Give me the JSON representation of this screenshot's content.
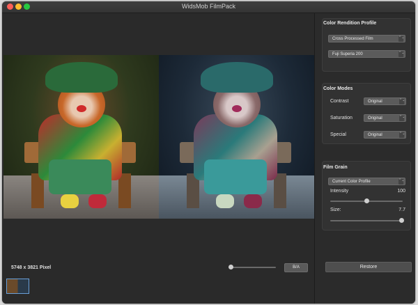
{
  "window": {
    "title": "WidsMob FilmPack"
  },
  "canvas": {
    "pixel_info": "5748 x 3821 Pixel",
    "zoom_level": 0.05,
    "ba_button_label": "B/A"
  },
  "color_rendition": {
    "title": "Color Rendition Profile",
    "profile_select": "Cross Processed Film",
    "film_select": "Fuji Superia 200"
  },
  "color_modes": {
    "title": "Color Modes",
    "rows": [
      {
        "label": "Contrast",
        "value": "Original"
      },
      {
        "label": "Saturation",
        "value": "Original"
      },
      {
        "label": "Special",
        "value": "Original"
      }
    ]
  },
  "film_grain": {
    "title": "Film Grain",
    "profile_select": "Current Color Profile",
    "intensity_label": "Intensity",
    "intensity_value": "100",
    "intensity_fraction": 0.5,
    "size_label": "Size:",
    "size_value": "7.7",
    "size_fraction": 0.98
  },
  "restore_label": "Restore",
  "icons": {
    "select_arrows": "⌃⌄"
  }
}
